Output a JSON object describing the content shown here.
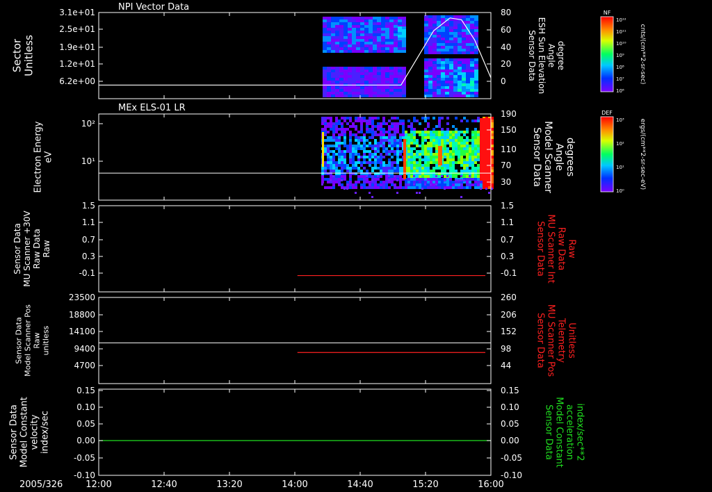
{
  "page": {
    "date_label": "2005/326"
  },
  "colors": {
    "frame": "#ffffff",
    "red_trace": "#ff2020",
    "green_trace": "#20e020",
    "green_label": "#20e020",
    "red_label": "#ff2020"
  },
  "time_axis": {
    "ticks": [
      "12:00",
      "12:40",
      "13:20",
      "14:00",
      "14:40",
      "15:20",
      "16:00"
    ]
  },
  "chart_data": [
    {
      "type": "heatmap",
      "title": "NPI Vector Data",
      "left_label": [
        "Sector",
        "Unitless"
      ],
      "left_ticks": [
        "3.1e+01",
        "2.5e+01",
        "1.9e+01",
        "1.2e+01",
        "6.2e+00"
      ],
      "right_label": [
        "Sensor Data",
        "ESH Sun Elevation",
        "Angle",
        "degree"
      ],
      "right_ticks": [
        "80",
        "60",
        "40",
        "20",
        "0"
      ],
      "right_ylim": [
        -15,
        80
      ],
      "overlay_line": {
        "name": "ESH Sun Elevation Angle",
        "x": [
          "12:00",
          "14:40",
          "15:05",
          "15:15",
          "15:25",
          "15:35",
          "15:42",
          "15:50",
          "16:00"
        ],
        "y": [
          0,
          0,
          0,
          30,
          60,
          74,
          72,
          50,
          8
        ]
      },
      "colorbar": {
        "label": "NF",
        "units": "cnts/(cm**2-sr-sec)",
        "ticks": [
          "10¹²",
          "10¹¹",
          "10¹⁰",
          "10⁹",
          "10⁸",
          "10⁷",
          "10⁶"
        ]
      }
    },
    {
      "type": "heatmap",
      "title": "MEx ELS-01 LR",
      "left_label": [
        "Electron Energy",
        "eV"
      ],
      "left_ticks": [
        "10²",
        "10¹"
      ],
      "right_label": [
        "Sensor Data",
        "Model Scanner",
        "Angle",
        "degrees"
      ],
      "right_ticks": [
        "190",
        "150",
        "110",
        "70",
        "30"
      ],
      "right_ylim": [
        0,
        190
      ],
      "overlay_line": {
        "name": "Model Scanner Angle",
        "x": [
          "12:00",
          "16:00"
        ],
        "y": [
          84,
          84
        ]
      },
      "colorbar": {
        "label": "DEF",
        "units": "ergs/(cm**2-sr-sec-eV)",
        "ticks": [
          "10³",
          "10²",
          "10¹",
          "10⁰"
        ]
      }
    },
    {
      "type": "line",
      "left_label": [
        "Sensor Data",
        "MU Scanner +30V",
        "Raw Data",
        "Raw"
      ],
      "left_ticks": [
        "1.5",
        "1.1",
        "0.7",
        "0.3",
        "-0.1"
      ],
      "right_label": [
        "Sensor Data",
        "MU Scanner Int",
        "Raw Data",
        "Raw"
      ],
      "right_ticks": [
        "1.5",
        "1.1",
        "0.7",
        "0.3",
        "-0.1"
      ],
      "ylim": [
        -0.35,
        1.5
      ],
      "series": [
        {
          "name": "MU Scanner Int Raw Data",
          "color": "#ff2020",
          "x": [
            "14:05",
            "16:00"
          ],
          "y": [
            0,
            0
          ]
        }
      ]
    },
    {
      "type": "line",
      "left_label": [
        "Sensor Data",
        "Model Scanner Pos",
        "Raw",
        "unitless"
      ],
      "left_ticks": [
        "23500",
        "18800",
        "14100",
        "9400",
        "4700"
      ],
      "right_label": [
        "Sensor Data",
        "MU Scanner Pos",
        "Telemetry",
        "Unitless"
      ],
      "right_ticks": [
        "260",
        "206",
        "152",
        "98",
        "44"
      ],
      "ylim": [
        0,
        23500
      ],
      "right_ylim": [
        0,
        260
      ],
      "series": [
        {
          "name": "Model Scanner Pos",
          "color": "#ffffff",
          "x": [
            "12:00",
            "16:00"
          ],
          "y": [
            11500,
            11500
          ]
        },
        {
          "name": "MU Scanner Pos Telemetry",
          "color": "#ff2020",
          "x": [
            "14:05",
            "16:00"
          ],
          "y": [
            98,
            98
          ]
        }
      ]
    },
    {
      "type": "line",
      "left_label": [
        "Sensor Data",
        "Model Constant",
        "velocity",
        "index/sec"
      ],
      "left_ticks": [
        "0.15",
        "0.10",
        "0.05",
        "0.00",
        "-0.05",
        "-0.10"
      ],
      "right_label": [
        "Sensor Data",
        "Model Constant",
        "acceleration",
        "index/sec**2"
      ],
      "right_ticks": [
        "0.15",
        "0.10",
        "0.05",
        "0.00",
        "-0.05",
        "-0.10"
      ],
      "ylim": [
        -0.1,
        0.15
      ],
      "series": [
        {
          "name": "Model Constant acceleration",
          "color": "#20e020",
          "x": [
            "12:00",
            "16:00"
          ],
          "y": [
            0,
            0
          ]
        }
      ]
    }
  ]
}
